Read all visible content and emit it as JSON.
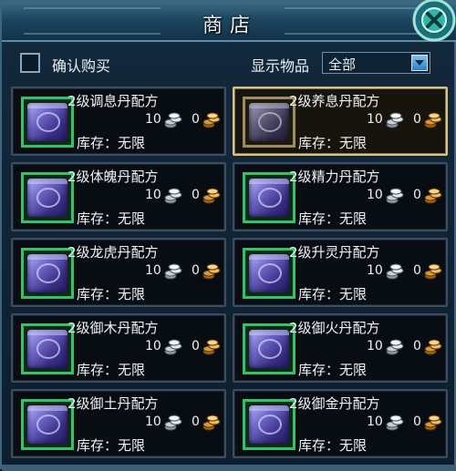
{
  "window": {
    "title": "商店"
  },
  "confirm": {
    "label": "确认购买",
    "checked": false
  },
  "filter": {
    "label": "显示物品",
    "value": "全部"
  },
  "items": [
    {
      "name": "2级调息丹配方",
      "silver": "10",
      "gold": "0",
      "stock": "库存：无限",
      "selected": false
    },
    {
      "name": "2级养息丹配方",
      "silver": "10",
      "gold": "0",
      "stock": "库存：无限",
      "selected": true
    },
    {
      "name": "2级体魄丹配方",
      "silver": "10",
      "gold": "0",
      "stock": "库存：无限",
      "selected": false
    },
    {
      "name": "2级精力丹配方",
      "silver": "10",
      "gold": "0",
      "stock": "库存：无限",
      "selected": false
    },
    {
      "name": "2级龙虎丹配方",
      "silver": "10",
      "gold": "0",
      "stock": "库存：无限",
      "selected": false
    },
    {
      "name": "2级升灵丹配方",
      "silver": "10",
      "gold": "0",
      "stock": "库存：无限",
      "selected": false
    },
    {
      "name": "2级御木丹配方",
      "silver": "10",
      "gold": "0",
      "stock": "库存：无限",
      "selected": false
    },
    {
      "name": "2级御火丹配方",
      "silver": "10",
      "gold": "0",
      "stock": "库存：无限",
      "selected": false
    },
    {
      "name": "2级御土丹配方",
      "silver": "10",
      "gold": "0",
      "stock": "库存：无限",
      "selected": false
    },
    {
      "name": "2级御金丹配方",
      "silver": "10",
      "gold": "0",
      "stock": "库存：无限",
      "selected": false
    }
  ],
  "colors": {
    "accent_green": "#35c06a",
    "selected_border": "#d8c583",
    "frame_blue": "#3d6580"
  }
}
